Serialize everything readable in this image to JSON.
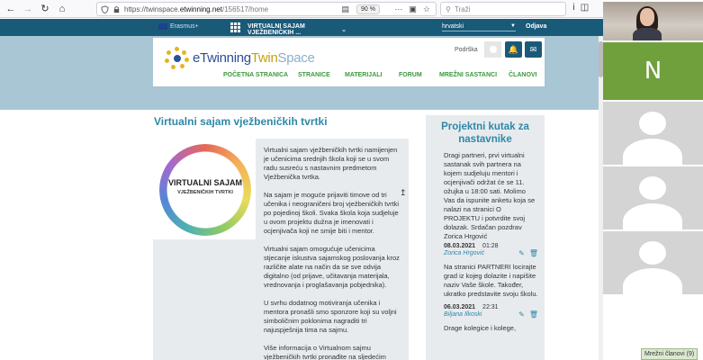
{
  "browser": {
    "url_scheme": "https://twinspace.",
    "url_host": "etwinning.net",
    "url_path": "/156517/home",
    "zoom": "90 %",
    "search_placeholder": "Traži"
  },
  "topbar": {
    "erasmus": "Erasmus+",
    "project": "VIRTUALNI SAJAM VJEŽBENIČKIH ...",
    "language": "hrvatski",
    "logout": "Odjava"
  },
  "header": {
    "logo_e": "eTwinning",
    "logo_tw": "Twin",
    "logo_space": "Space",
    "support": "Podrška"
  },
  "nav": {
    "items": [
      "POČETNA STRANICA",
      "STRANICE",
      "MATERIJALI",
      "FORUM",
      "MREŽNI SASTANCI",
      "ČLANOVI"
    ]
  },
  "main": {
    "title": "Virtualni sajam vježbeničkih tvrtki",
    "image_title": "VIRTUALNI SAJAM",
    "image_subtitle": "VJEŽBENIČKIH TVRTKI",
    "paragraphs": [
      "Virtualni sajam vježbeničkih tvrtki namijenjen je učenicima srednjih škola koji se u svom radu susreću s nastavnim predmetom Vježbenička tvrtka.",
      "Na sajam je moguće prijaviti timove od tri učenika i neograničeni broj vježbeničkih tvrtki po pojedinoj školi. Svaka škola koja sudjeluje u ovom projektu dužna je imenovati i ocjenjivača koji ne smije biti i mentor.",
      "Virtualni sajam omogućuje učenicima stjecanje iskustva sajamskog poslovanja kroz različite alate na način da se sve odvija digitalno (od prijave, učitavanja materijala, vrednovanja i proglašavanja pobjednika).",
      "U svrhu dodatnog motiviranja učenika i mentora pronašli smo sponzore koji su voljni simboličnim poklonima nagraditi tri najuspješnija tima na sajmu.",
      "Više informacija o Virtualnom sajmu vježbeničkih tvrtki pronađite na sljedećim stranicama:"
    ]
  },
  "side": {
    "title": "Projektni kutak za nastavnike",
    "posts": [
      {
        "text": "Dragi partneri, prvi virtualni sastanak svih partnera na kojem sudjeluju mentori i ocjenjivači održat će se 11. ožujka u 18:00 sati. Molimo Vas da ispunite anketu koja se nalazi na stranici O PROJEKTU i potvrdite svoj dolazak. Srdačan pozdrav Zorica Hrgović",
        "date": "08.03.2021",
        "time": "01:28",
        "author": "Zorica Hrgović"
      },
      {
        "text": "Na stranici PARTNERI locirajte grad iz kojeg dolazite i napišite naziv Vaše škole. Također, ukratko predstavite svoju školu.",
        "date": "06.03.2021",
        "time": "22:31",
        "author": "Biljana Ilkoski"
      },
      {
        "text": "Drage kolegice i kolege,"
      }
    ]
  },
  "meeting": {
    "participant_initial": "N",
    "members_label": "Mrežni članovi (9)"
  },
  "colors": {
    "topbar": "#1a5a79",
    "header_bg": "#a8c6d4",
    "title": "#2e88a9",
    "nav_green": "#3a9a3c",
    "panel_bg": "#e8ebee"
  }
}
